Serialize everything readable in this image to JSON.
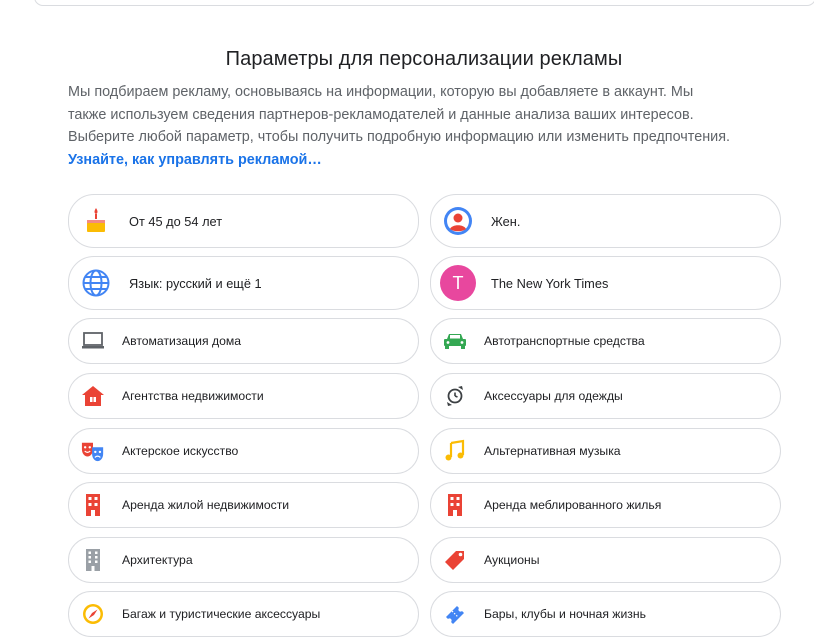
{
  "page": {
    "title": "Параметры для персонализации рекламы",
    "description_lines": [
      "Мы подбираем рекламу, основываясь на информации, которую вы добавляете в аккаунт. Мы",
      "также используем сведения партнеров-рекламодателей и данные анализа ваших интересов.",
      "Выберите любой параметр, чтобы получить подробную информацию или изменить предпочтения."
    ],
    "learn_more": "Узнайте, как управлять рекламой…"
  },
  "chips": [
    {
      "label": "От 45 до 54 лет",
      "icon": "birthday-cake-icon"
    },
    {
      "label": "Жен.",
      "icon": "person-icon"
    },
    {
      "label": "Язык: русский и ещё 1",
      "icon": "globe-icon"
    },
    {
      "label": "The New York Times",
      "icon": "letter-avatar-icon",
      "avatar_letter": "T",
      "avatar_color": "#e8479e"
    },
    {
      "label": "Автоматизация дома",
      "icon": "laptop-icon"
    },
    {
      "label": "Автотранспортные средства",
      "icon": "car-icon"
    },
    {
      "label": "Агентства недвижимости",
      "icon": "house-icon"
    },
    {
      "label": "Аксессуары для одежды",
      "icon": "watch-icon"
    },
    {
      "label": "Актерское искусство",
      "icon": "theater-masks-icon"
    },
    {
      "label": "Альтернативная музыка",
      "icon": "music-note-icon"
    },
    {
      "label": "Аренда жилой недвижимости",
      "icon": "building-icon"
    },
    {
      "label": "Аренда меблированного жилья",
      "icon": "building-icon"
    },
    {
      "label": "Архитектура",
      "icon": "office-building-icon"
    },
    {
      "label": "Аукционы",
      "icon": "price-tag-icon"
    },
    {
      "label": "Багаж и туристические аксессуары",
      "icon": "compass-icon"
    },
    {
      "label": "Бары, клубы и ночная жизнь",
      "icon": "ticket-icon"
    }
  ],
  "colors": {
    "link": "#1a73e8",
    "border": "#dadce0",
    "text_secondary": "#5f6368",
    "red": "#ea4335",
    "green": "#34a853",
    "blue": "#4285f4",
    "yellow": "#fbbc04"
  }
}
